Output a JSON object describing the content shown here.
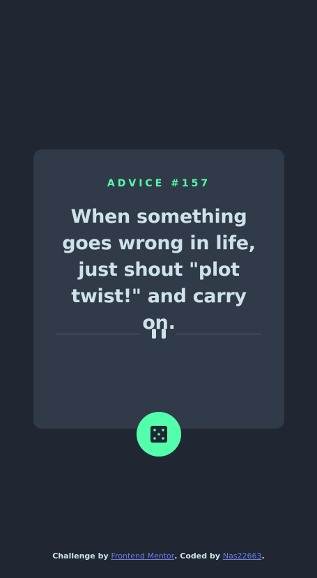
{
  "card": {
    "advice_id": "ADVICE #157",
    "quote": "When something goes wrong in life, just shout \"plot twist!\" and carry on."
  },
  "dice_button": {
    "icon": "dice-icon"
  },
  "divider": {
    "icon": "pause-icon"
  },
  "attribution": {
    "prefix": "Challenge by ",
    "challenge_link": "Frontend Mentor",
    "middle": ". Coded by ",
    "author_link": "Nas22663",
    "suffix": "."
  },
  "colors": {
    "background": "#202733",
    "card": "#313a48",
    "accent": "#53ffaa",
    "text": "#cee3e9",
    "link": "#6b7fe3",
    "divider": "#4f5d74"
  }
}
